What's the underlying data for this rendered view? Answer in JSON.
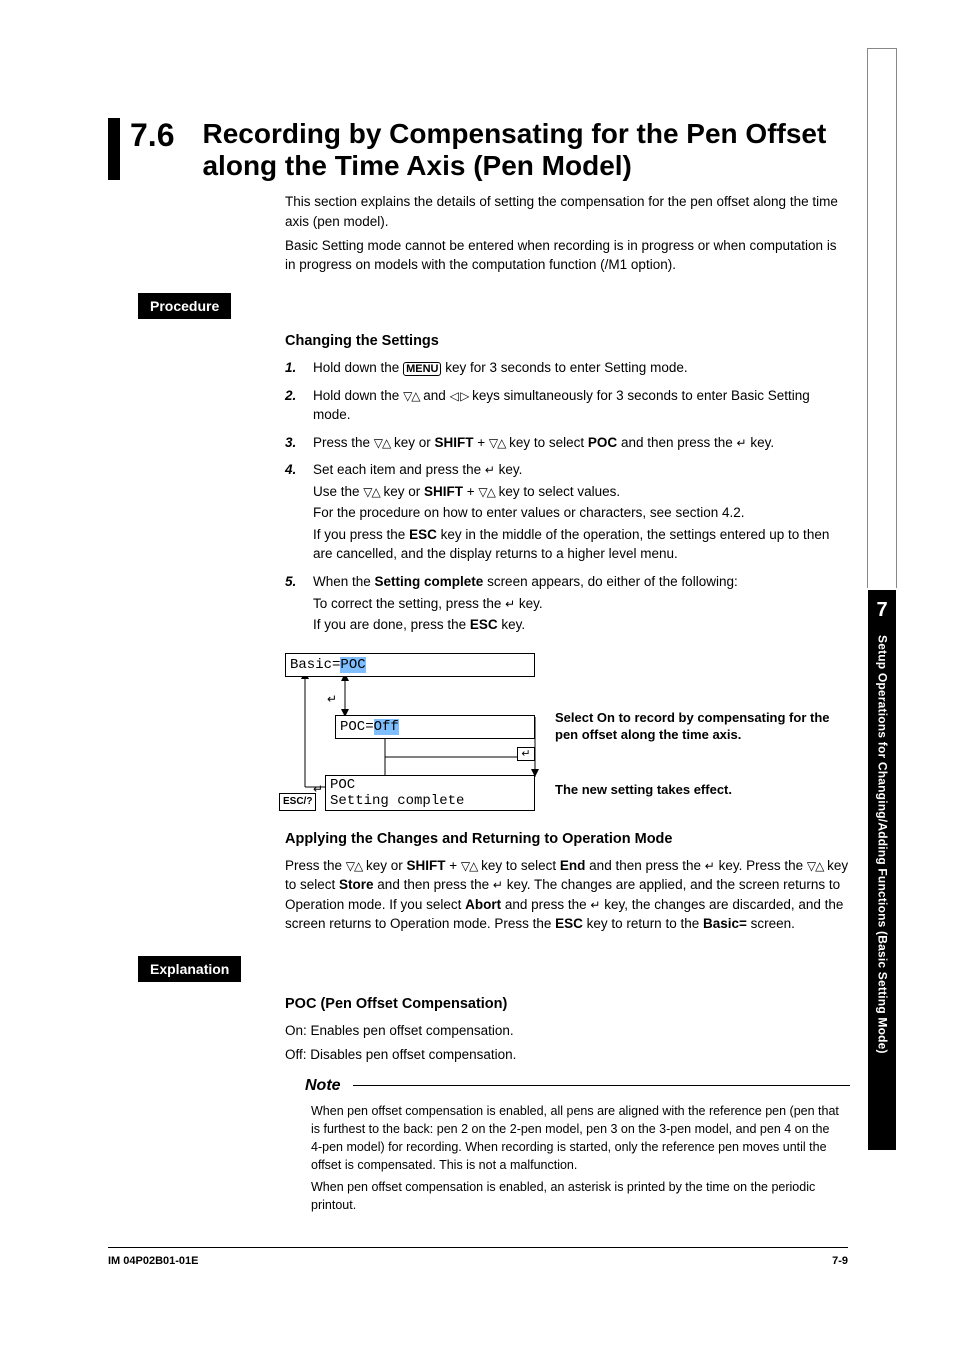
{
  "section": {
    "number": "7.6",
    "title": "Recording by Compensating for the Pen Offset along the Time Axis (Pen Model)"
  },
  "intro": [
    "This section explains the details of setting the compensation for the pen offset along the time axis (pen model).",
    "Basic Setting mode cannot be entered when recording is in progress or when computation is in progress on models with the computation function (/M1 option)."
  ],
  "procedure": {
    "tag": "Procedure",
    "changing_heading": "Changing the Settings",
    "steps": {
      "s1": {
        "num": "1.",
        "pre": "Hold down the ",
        "menu": "MENU",
        "post": " key for 3 seconds to enter Setting mode."
      },
      "s2": {
        "num": "2.",
        "pre": "Hold down the ",
        "mid": " and ",
        "post": " keys simultaneously for 3 seconds to enter Basic Setting mode."
      },
      "s3": {
        "num": "3.",
        "pre": "Press the ",
        "mid1": " key or ",
        "shift": "SHIFT",
        "mid2": " + ",
        "mid3": " key to select ",
        "poc": "POC",
        "mid4": " and then press the ",
        "post": " key."
      },
      "s4": {
        "num": "4.",
        "l1a": "Set each item and press the ",
        "l1b": " key.",
        "l2a": "Use the ",
        "l2b": " key or ",
        "shift": "SHIFT",
        "l2c": " + ",
        "l2d": " key to select values.",
        "l3": "For the procedure on how to enter values or characters, see section 4.2.",
        "l4a": "If you press the ",
        "esc": "ESC",
        "l4b": " key in the middle of the operation, the settings entered up to then are cancelled, and the display returns to a higher level menu."
      },
      "s5": {
        "num": "5.",
        "l1a": "When the ",
        "sc": "Setting complete",
        "l1b": " screen appears, do either of the following:",
        "l2a": "To correct the setting, press the ",
        "l2b": " key.",
        "l3a": "If you are done, press the ",
        "esc": "ESC",
        "l3b": " key."
      }
    },
    "diagram": {
      "box1a": "Basic=",
      "box1b": "POC",
      "box2a": "POC=",
      "box2b": "Off",
      "box3l1": "POC",
      "box3l2": "Setting complete",
      "esc": "ESC/?",
      "note1": "Select On to record by compensating for the pen offset along the time axis.",
      "note2": "The new setting takes effect."
    },
    "applying_heading": "Applying the Changes and Returning to Operation Mode",
    "applying": {
      "t1": "Press the ",
      "t2": " key or ",
      "shift": "SHIFT",
      "t3": " + ",
      "t4": " key to select ",
      "end": "End",
      "t5": " and then press the ",
      "t6": " key. Press the ",
      "t7": " key to select ",
      "store": "Store",
      "t8": " and then press the ",
      "t9": " key. The changes are applied, and the screen returns to Operation mode. If you select ",
      "abort": "Abort",
      "t10": " and press the ",
      "t11": " key, the changes are discarded, and the screen returns to Operation mode. Press the ",
      "esc": "ESC",
      "t12": " key to return to the ",
      "basic": "Basic=",
      "t13": " screen."
    }
  },
  "explanation": {
    "tag": "Explanation",
    "poc_heading": "POC (Pen Offset Compensation)",
    "on": "On: Enables pen offset compensation.",
    "off": "Off: Disables pen offset compensation.",
    "note_label": "Note",
    "note1": "When pen offset compensation is enabled, all pens are aligned with the reference pen (pen that is furthest to the back: pen 2 on the 2-pen model, pen 3 on the 3-pen model, and pen 4 on the 4-pen model) for recording. When recording is started, only the reference pen moves until the offset is compensated. This is not a malfunction.",
    "note2": "When pen offset compensation is enabled, an asterisk is printed by the time on the periodic printout."
  },
  "side": {
    "chapter": "7",
    "text": "Setup Operations for Changing/Adding Functions (Basic Setting Mode)"
  },
  "footer": {
    "left": "IM 04P02B01-01E",
    "right": "7-9"
  },
  "icons": {
    "updown": "▽△",
    "leftright": "◁ ▷",
    "enter": "↵"
  }
}
